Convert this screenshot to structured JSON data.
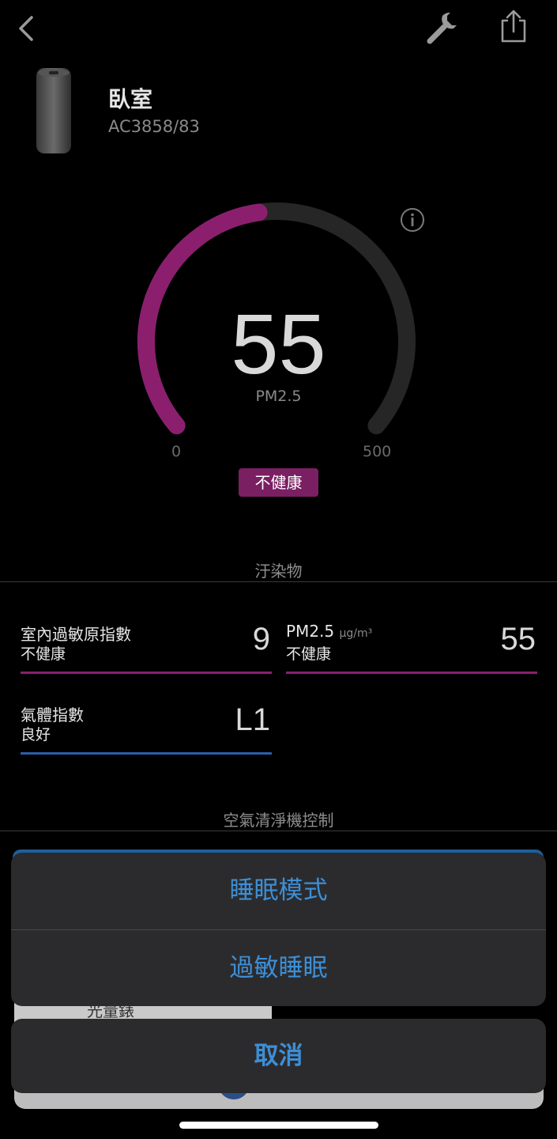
{
  "header": {
    "back_icon": "chevron-left-icon",
    "settings_icon": "wrench-icon",
    "share_icon": "share-icon"
  },
  "device": {
    "room": "臥室",
    "model": "AC3858/83"
  },
  "air_quality": {
    "value": "55",
    "label": "PM2.5",
    "min": "0",
    "max": "500",
    "status": "不健康",
    "gauge_fraction": 0.47,
    "accent_color": "#8b1f6e"
  },
  "pollutants": {
    "title": "汙染物",
    "items": [
      {
        "name": "室內過敏原指數",
        "unit": "",
        "status": "不健康",
        "value": "9",
        "color": "#8b1f6e"
      },
      {
        "name": "PM2.5",
        "unit": "µg/m³",
        "status": "不健康",
        "value": "55",
        "color": "#8b1f6e"
      },
      {
        "name": "氣體指數",
        "unit": "",
        "status": "良好",
        "value": "L1",
        "color": "#2a5fa8"
      }
    ]
  },
  "controls": {
    "title": "空氣清淨機控制"
  },
  "action_sheet": {
    "options": [
      "睡眠模式",
      "過敏睡眠"
    ],
    "cancel": "取消",
    "peek_text": "光量錶"
  }
}
